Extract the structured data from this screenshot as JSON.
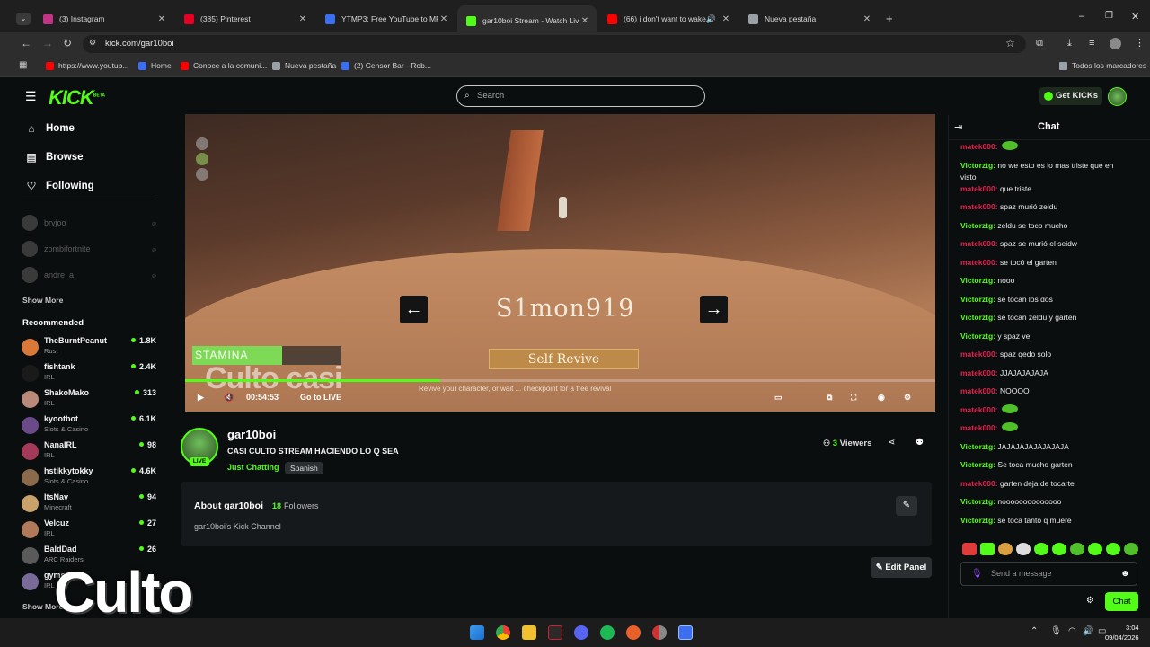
{
  "browser": {
    "tabs": [
      {
        "title": "(3) Instagram",
        "color": "#c13584"
      },
      {
        "title": "(385) Pinterest",
        "color": "#e60023"
      },
      {
        "title": "YTMP3: Free YouTube to MP3 C",
        "color": "#3b6ef0"
      },
      {
        "title": "gar10boi Stream - Watch Live o",
        "color": "#53fc18"
      },
      {
        "title": "(66) i don't want to wake u",
        "color": "#ff0000"
      },
      {
        "title": "Nueva pestaña",
        "color": "#9aa0a6"
      }
    ],
    "url": "kick.com/gar10boi",
    "bookmarks": [
      {
        "label": "https://www.youtub...",
        "color": "#ff0000"
      },
      {
        "label": "Home",
        "color": "#3b6ef0"
      },
      {
        "label": "Conoce a la comuni...",
        "color": "#ff0000"
      },
      {
        "label": "Nueva pestaña",
        "color": "#9aa0a6"
      },
      {
        "label": "(2) Censor Bar - Rob...",
        "color": "#3b6ef0"
      }
    ],
    "all_bookmarks": "Todos los marcadores"
  },
  "kick": {
    "logo": "KICK",
    "logo_tag": "BETA",
    "search_placeholder": "Search",
    "get_kicks": "Get KICKs"
  },
  "sidebar": {
    "nav": [
      {
        "label": "Home",
        "icon": "home-icon",
        "glyph": "⌂"
      },
      {
        "label": "Browse",
        "icon": "browse-icon",
        "glyph": "▤"
      },
      {
        "label": "Following",
        "icon": "heart-icon",
        "glyph": "♡"
      }
    ],
    "offline_following": [
      "brvjoo",
      "zombifortnite",
      "andre_a"
    ],
    "show_more": "Show More",
    "recommended_title": "Recommended",
    "recommended": [
      {
        "name": "TheBurntPeanut",
        "category": "Rust",
        "viewers": "1.8K",
        "color": "#d8793a"
      },
      {
        "name": "fishtank",
        "category": "IRL",
        "viewers": "2.4K",
        "color": "#1a1a1a"
      },
      {
        "name": "ShakoMako",
        "category": "IRL",
        "viewers": "313",
        "color": "#b98a7a"
      },
      {
        "name": "kyootbot",
        "category": "Slots & Casino",
        "viewers": "6.1K",
        "color": "#6b4a8a"
      },
      {
        "name": "NanaIRL",
        "category": "IRL",
        "viewers": "98",
        "color": "#a33a5a"
      },
      {
        "name": "hstikkytokky",
        "category": "Slots & Casino",
        "viewers": "4.6K",
        "color": "#8a6a4a"
      },
      {
        "name": "ItsNav",
        "category": "Minecraft",
        "viewers": "94",
        "color": "#c9a26a"
      },
      {
        "name": "Velcuz",
        "category": "IRL",
        "viewers": "27",
        "color": "#b07a5a"
      },
      {
        "name": "BaldDad",
        "category": "ARC Raiders",
        "viewers": "26",
        "color": "#5a5a5a"
      },
      {
        "name": "gymskin",
        "category": "IRL",
        "viewers": "",
        "color": "#7a6a9a"
      }
    ],
    "show_more_bottom": "Show More"
  },
  "video": {
    "player_name": "S1mon919",
    "self_revive": "Self Revive",
    "stamina_label": "STAMINA",
    "stamina_level": 0.6,
    "revive_hint": "Revive your character, or wait ... checkpoint for a free revival",
    "elapsed": "00:54:53",
    "go_live": "Go to LIVE",
    "progress": 0.34,
    "overlay_text": "Culto casi"
  },
  "stream": {
    "streamer": "gar10boi",
    "title": "CASI CULTO STREAM HACIENDO LO Q SEA",
    "category": "Just Chatting",
    "language": "Spanish",
    "live_badge": "LIVE",
    "viewers_count": "3",
    "viewers_label": "Viewers"
  },
  "about": {
    "title": "About gar10boi",
    "followers_count": "18",
    "followers_label": "Followers",
    "description": "gar10boi's Kick Channel",
    "edit_panel": "Edit Panel"
  },
  "chat": {
    "title": "Chat",
    "messages": [
      {
        "user": "matek000:",
        "text": "",
        "color": "#e0224e"
      },
      {
        "user": "Victorztg:",
        "text": "no we esto es lo mas triste que eh visto",
        "color": "#53fc18"
      },
      {
        "user": "matek000:",
        "text": "que triste",
        "color": "#e0224e"
      },
      {
        "user": "matek000:",
        "text": "spaz murió zeldu",
        "color": "#e0224e"
      },
      {
        "user": "Victorztg:",
        "text": "zeldu se toco mucho",
        "color": "#53fc18"
      },
      {
        "user": "matek000:",
        "text": "spaz se murió el seidw",
        "color": "#e0224e"
      },
      {
        "user": "matek000:",
        "text": "se tocó el garten",
        "color": "#e0224e"
      },
      {
        "user": "Victorztg:",
        "text": "nooo",
        "color": "#53fc18"
      },
      {
        "user": "Victorztg:",
        "text": "se tocan los dos",
        "color": "#53fc18"
      },
      {
        "user": "Victorztg:",
        "text": "se tocan zeldu y garten",
        "color": "#53fc18"
      },
      {
        "user": "Victorztg:",
        "text": "y spaz ve",
        "color": "#53fc18"
      },
      {
        "user": "matek000:",
        "text": "spaz qedo solo",
        "color": "#e0224e"
      },
      {
        "user": "matek000:",
        "text": "JJAJAJAJAJA",
        "color": "#e0224e"
      },
      {
        "user": "matek000:",
        "text": "NOOOO",
        "color": "#e0224e"
      },
      {
        "user": "matek000:",
        "text": "",
        "color": "#e0224e"
      },
      {
        "user": "matek000:",
        "text": "",
        "color": "#e0224e"
      },
      {
        "user": "Victorztg:",
        "text": "JAJAJAJAJAJAJAJA",
        "color": "#53fc18"
      },
      {
        "user": "Victorztg:",
        "text": "Se toca mucho garten",
        "color": "#53fc18"
      },
      {
        "user": "matek000:",
        "text": "garten deja de tocarte",
        "color": "#e0224e"
      },
      {
        "user": "Victorztg:",
        "text": "noooooooooooooo",
        "color": "#53fc18"
      },
      {
        "user": "Victorztg:",
        "text": "se toca tanto q muere",
        "color": "#53fc18"
      }
    ],
    "input_placeholder": "Send a message",
    "send_label": "Chat"
  },
  "watermark": {
    "text": "Culto"
  },
  "taskbar": {
    "time": "3:04",
    "date": "09/04/2026"
  }
}
